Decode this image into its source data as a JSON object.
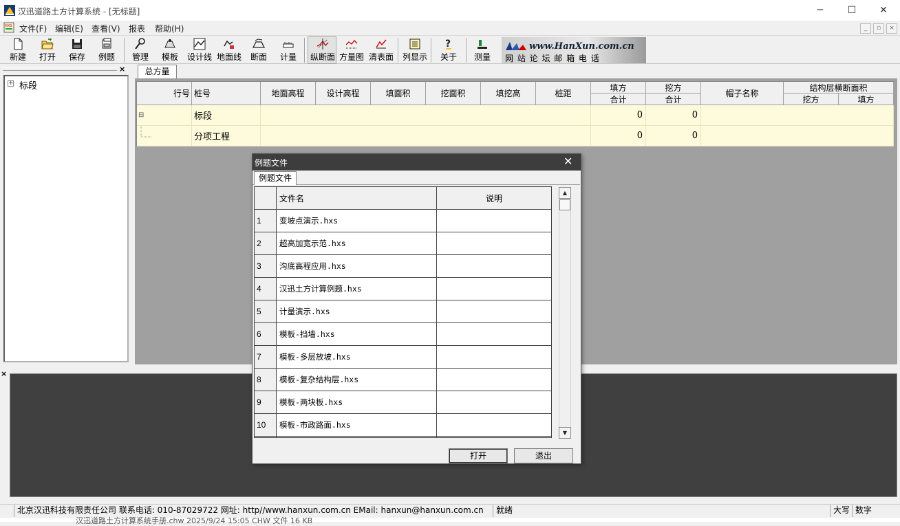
{
  "window": {
    "title": "汉迅道路土方计算系统 - [无标题]",
    "controls": {
      "minimize": "─",
      "maximize": "☐",
      "close": "✕"
    }
  },
  "menubar": {
    "items": [
      "文件(F)",
      "编辑(E)",
      "查看(V)",
      "报表",
      "帮助(H)"
    ],
    "mdi_controls": [
      "_",
      "▫",
      "×"
    ]
  },
  "toolbar": {
    "buttons": [
      {
        "label": "新建",
        "icon": "new-file-icon"
      },
      {
        "label": "打开",
        "icon": "open-folder-icon"
      },
      {
        "label": "保存",
        "icon": "save-icon"
      },
      {
        "label": "例题",
        "icon": "examples-icon"
      },
      {
        "label": "管理",
        "icon": "wrench-icon"
      },
      {
        "label": "模板",
        "icon": "template-icon"
      },
      {
        "label": "设计线",
        "icon": "design-line-icon"
      },
      {
        "label": "地面线",
        "icon": "ground-line-icon"
      },
      {
        "label": "断面",
        "icon": "cross-section-icon"
      },
      {
        "label": "计量",
        "icon": "measure-icon"
      },
      {
        "label": "纵断面",
        "icon": "profile-icon"
      },
      {
        "label": "方量图",
        "icon": "volume-chart-icon"
      },
      {
        "label": "清表面",
        "icon": "clear-surface-icon"
      },
      {
        "label": "列显示",
        "icon": "column-display-icon"
      },
      {
        "label": "关于",
        "icon": "help-icon"
      },
      {
        "label": "测量",
        "icon": "survey-icon"
      }
    ],
    "active": "纵断面",
    "banner": {
      "url": "www.HanXun.com.cn",
      "links": "网 站 论 坛 邮 箱 电 话"
    }
  },
  "tree": {
    "root": {
      "label": "标段",
      "expander": "+"
    }
  },
  "main": {
    "tab": "总方量",
    "columns": {
      "row_no": "行号",
      "station": "桩号",
      "ground_elev": "地面高程",
      "design_elev": "设计高程",
      "fill_area": "填面积",
      "cut_area": "挖面积",
      "cut_fill_height": "填挖高",
      "distance": "桩距",
      "fill_group": "填方",
      "fill_sub": "合计",
      "cut_group": "挖方",
      "cut_sub": "合计",
      "hat_name": "帽子名称",
      "struct_group": "结构层横断面积",
      "struct_cut": "挖方",
      "struct_fill": "填方"
    },
    "rows": [
      {
        "expander": "⊟",
        "station": "标段",
        "fill_total": "0",
        "cut_total": "0"
      },
      {
        "expander": "",
        "station": "分项工程",
        "fill_total": "0",
        "cut_total": "0"
      }
    ]
  },
  "dialog": {
    "title": "例题文件",
    "tab": "例题文件",
    "columns": {
      "name": "文件名",
      "desc": "说明"
    },
    "rows": [
      {
        "no": "1",
        "name": "变坡点演示.hxs",
        "desc": ""
      },
      {
        "no": "2",
        "name": "超高加宽示范.hxs",
        "desc": ""
      },
      {
        "no": "3",
        "name": "沟底高程应用.hxs",
        "desc": ""
      },
      {
        "no": "4",
        "name": "汉迅土方计算例题.hxs",
        "desc": ""
      },
      {
        "no": "5",
        "name": "计量演示.hxs",
        "desc": ""
      },
      {
        "no": "6",
        "name": "模板-挡墙.hxs",
        "desc": ""
      },
      {
        "no": "7",
        "name": "模板-多层放坡.hxs",
        "desc": ""
      },
      {
        "no": "8",
        "name": "模板-复杂结构层.hxs",
        "desc": ""
      },
      {
        "no": "9",
        "name": "模板-两块板.hxs",
        "desc": ""
      },
      {
        "no": "10",
        "name": "模板-市政路面.hxs",
        "desc": ""
      }
    ],
    "buttons": {
      "open": "打开",
      "exit": "退出"
    }
  },
  "statusbar": {
    "company": "北京汉迅科技有限责任公司  联系电话: 010-87029722  网址: http//www.hanxun.com.cn    EMail: hanxun@hanxun.com.cn",
    "status": "就绪",
    "caps": "大写",
    "num": "数字"
  },
  "behind": {
    "text": "汉迅道路土方计算系统手册.chw                2025/9/24 15:05           CHW 文件               16 KB"
  },
  "colors": {
    "grid_row_bg": "#fdfbdc",
    "dialog_title_bg": "#3d3d3d",
    "panel_dark": "#404040",
    "workspace": "#a0a0a0"
  }
}
